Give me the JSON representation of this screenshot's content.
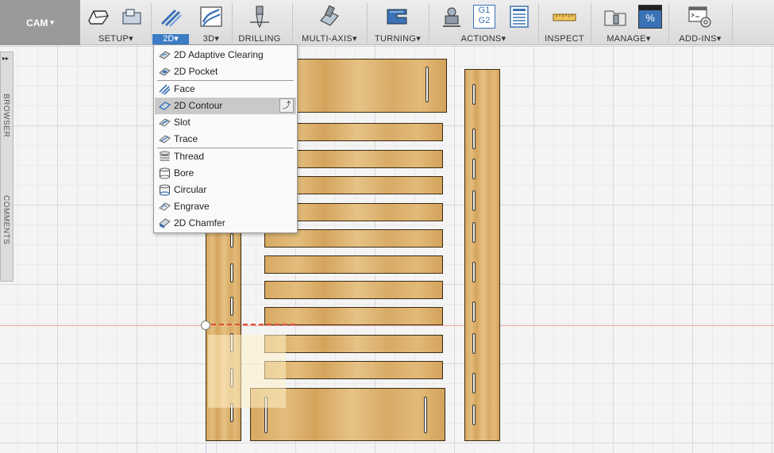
{
  "workspace": {
    "label": "CAM"
  },
  "toolbar": {
    "groups": {
      "setup": "SETUP",
      "two_d": "2D",
      "three_d": "3D",
      "drilling": "DRILLING",
      "multi_axis": "MULTI-AXIS",
      "turning": "TURNING",
      "actions": "ACTIONS",
      "inspect": "INSPECT",
      "manage": "MANAGE",
      "add_ins": "ADD-INS"
    },
    "dropdown_arrow": "▾",
    "actions_icon_text": [
      "G1",
      "G2"
    ],
    "manage_icon_text": "%"
  },
  "sidebar": {
    "expand_glyph": "▸▸",
    "browser": "BROWSER",
    "comments": "COMMENTS"
  },
  "menu_2d": {
    "items": [
      {
        "label": "2D Adaptive Clearing",
        "icon": "adaptive-clearing-icon"
      },
      {
        "label": "2D Pocket",
        "icon": "pocket-icon"
      },
      {
        "label": "Face",
        "icon": "face-icon"
      },
      {
        "label": "2D Contour",
        "icon": "contour-icon",
        "highlighted": true
      },
      {
        "label": "Slot",
        "icon": "slot-icon"
      },
      {
        "label": "Trace",
        "icon": "trace-icon"
      },
      {
        "label": "Thread",
        "icon": "thread-icon"
      },
      {
        "label": "Bore",
        "icon": "bore-icon"
      },
      {
        "label": "Circular",
        "icon": "circular-icon"
      },
      {
        "label": "Engrave",
        "icon": "engrave-icon"
      },
      {
        "label": "2D Chamfer",
        "icon": "chamfer-icon"
      }
    ],
    "pin_glyph": "⤴"
  },
  "colors": {
    "accent": "#3b7cc4",
    "wood": "#dcb06c",
    "axis_red": "#e04a3a"
  }
}
